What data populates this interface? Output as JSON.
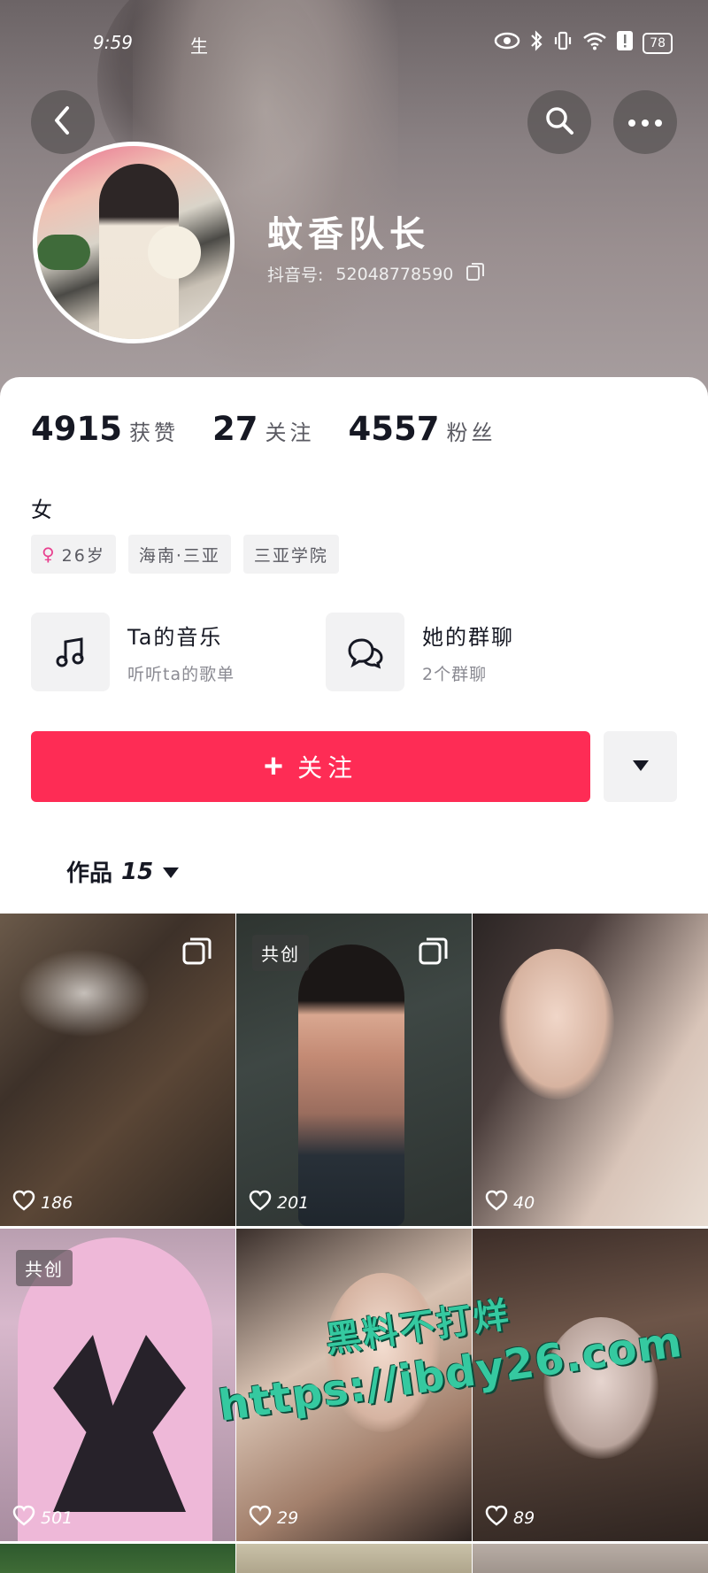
{
  "status_bar": {
    "time": "9:59",
    "carrier_char": "生",
    "battery": "78"
  },
  "header": {
    "nickname": "蚊香队长",
    "douyin_id_label": "抖音号:",
    "douyin_id": "52048778590"
  },
  "stats": [
    {
      "num": "4915",
      "label": "获赞"
    },
    {
      "num": "27",
      "label": "关注"
    },
    {
      "num": "4557",
      "label": "粉丝"
    }
  ],
  "bio": "女",
  "tags": [
    {
      "text": "26岁",
      "icon": "female-icon"
    },
    {
      "text": "海南·三亚"
    },
    {
      "text": "三亚学院"
    }
  ],
  "features": [
    {
      "title": "Ta的音乐",
      "subtitle": "听听ta的歌单",
      "icon": "music-note-icon"
    },
    {
      "title": "她的群聊",
      "subtitle": "2个群聊",
      "icon": "chat-bubbles-icon"
    }
  ],
  "actions": {
    "follow_label": "关注"
  },
  "works_tab": {
    "label": "作品",
    "count": "15"
  },
  "videos": [
    {
      "likes": "186",
      "badge": "",
      "multi": true
    },
    {
      "likes": "201",
      "badge": "共创",
      "multi": true
    },
    {
      "likes": "40",
      "badge": "",
      "multi": false
    },
    {
      "likes": "501",
      "badge": "共创",
      "multi": false
    },
    {
      "likes": "29",
      "badge": "",
      "multi": false
    },
    {
      "likes": "89",
      "badge": "",
      "multi": false
    }
  ],
  "watermark": {
    "line1": "黑料不打烊",
    "line2": "https://ibdy26.com"
  },
  "colors": {
    "accent": "#fe2c55",
    "tag_bg": "#f2f2f3",
    "watermark": "#35c9a0"
  }
}
